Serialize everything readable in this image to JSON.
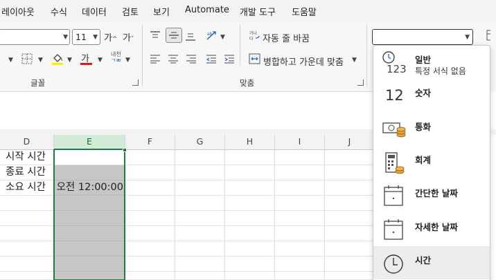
{
  "menu": {
    "tabs": [
      "레이아웃",
      "수식",
      "데이터",
      "검토",
      "보기",
      "Automate",
      "개발 도구",
      "도움말"
    ]
  },
  "ribbon": {
    "font_size": "11",
    "grow_font": "가",
    "shrink_font": "가",
    "font_color_glyph": "가",
    "phonetic_glyph": "내천",
    "wrap_text_label": "자동 줄 바꿈",
    "merge_center_label": "병합하고 가운데 맞춤",
    "group_font_label": "글꼴",
    "group_alignment_label": "맞춤",
    "number_format_value": ""
  },
  "sheet": {
    "columns": [
      "D",
      "E",
      "F",
      "G",
      "H",
      "I",
      "J"
    ],
    "selected_column": "E",
    "cells": {
      "D1": "시작 시간",
      "D2": "종료 시간",
      "D3": "소요 시간",
      "E3": "오전 12:00:00"
    }
  },
  "format_dropdown": {
    "items": [
      {
        "label": "일반",
        "sub": "특정 서식 없음",
        "icon": "general-clock-123-icon"
      },
      {
        "label": "숫자",
        "icon_text": "12",
        "icon": "number-icon"
      },
      {
        "label": "통화",
        "icon": "currency-icon"
      },
      {
        "label": "회계",
        "icon": "accounting-icon"
      },
      {
        "label": "간단한 날짜",
        "icon": "short-date-icon"
      },
      {
        "label": "자세한 날짜",
        "icon": "long-date-icon"
      },
      {
        "label": "시간",
        "icon": "time-icon"
      }
    ],
    "highlighted_index": 6
  },
  "colors": {
    "accent_green": "#1f7a43",
    "selected_header_bg": "#d3ead9",
    "selected_range_fill": "#c6c6c6",
    "font_color_underline": "#e81123",
    "highlight_underline": "#ffeb00",
    "merge_icon_blue": "#1e62c4",
    "coin_gold": "#e8a33a"
  }
}
